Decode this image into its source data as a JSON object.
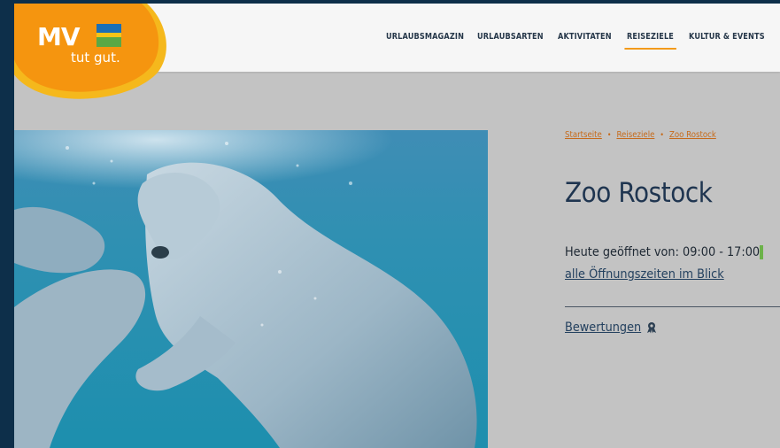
{
  "logo": {
    "brand": "MV",
    "tagline": "tut gut.",
    "colors": {
      "orange": "#f5950f",
      "blue": "#1b6fb5",
      "green": "#5aa845",
      "yellow": "#f5c518"
    }
  },
  "nav": {
    "items": [
      {
        "label": "URLAUBSMAGAZIN",
        "active": false
      },
      {
        "label": "URLAUBSARTEN",
        "active": false
      },
      {
        "label": "AKTIVITÄTEN",
        "active": false
      },
      {
        "label": "REISEZIELE",
        "active": true
      },
      {
        "label": "KULTUR & EVENTS",
        "active": false
      }
    ],
    "accent": "#f29a1a"
  },
  "hero": {
    "icon": "polar-bears-underwater-photo"
  },
  "breadcrumb": {
    "items": [
      "Startseite",
      "Reiseziele",
      "Zoo Rostock"
    ],
    "separator": "•"
  },
  "page": {
    "title": "Zoo Rostock",
    "hours_text": "Heute geöffnet von: 09:00 - 17:00",
    "open_status_color": "#6cb24a",
    "hours_link": "alle Öffnungszeiten im Blick",
    "reviews_label": "Bewertungen",
    "reviews_icon": "award-ribbon-icon"
  }
}
